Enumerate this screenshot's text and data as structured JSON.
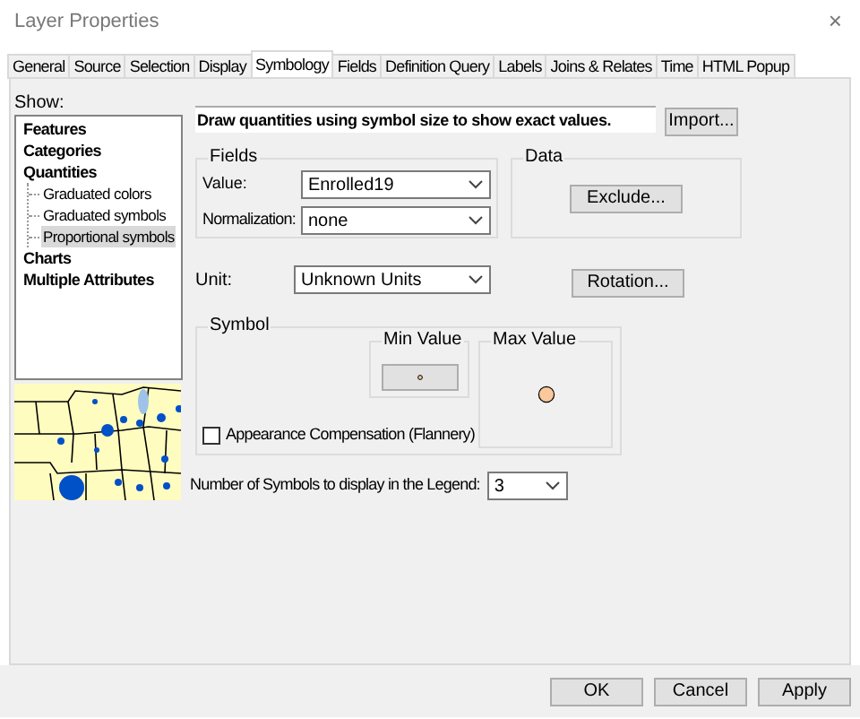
{
  "window": {
    "title": "Layer Properties",
    "close": "×"
  },
  "tabs": [
    {
      "label": "General",
      "selected": false
    },
    {
      "label": "Source",
      "selected": false
    },
    {
      "label": "Selection",
      "selected": false
    },
    {
      "label": "Display",
      "selected": false
    },
    {
      "label": "Symbology",
      "selected": true
    },
    {
      "label": "Fields",
      "selected": false
    },
    {
      "label": "Definition Query",
      "selected": false
    },
    {
      "label": "Labels",
      "selected": false
    },
    {
      "label": "Joins & Relates",
      "selected": false
    },
    {
      "label": "Time",
      "selected": false
    },
    {
      "label": "HTML Popup",
      "selected": false
    }
  ],
  "show": {
    "label": "Show:",
    "tree": [
      {
        "label": "Features",
        "selected": false
      },
      {
        "label": "Categories",
        "selected": false
      },
      {
        "label": "Quantities",
        "selected": false,
        "children": [
          {
            "label": "Graduated colors",
            "selected": false
          },
          {
            "label": "Graduated symbols",
            "selected": false
          },
          {
            "label": "Proportional symbols",
            "selected": true
          }
        ]
      },
      {
        "label": "Charts",
        "selected": false
      },
      {
        "label": "Multiple Attributes",
        "selected": false
      }
    ]
  },
  "description": "Draw quantities using symbol size to show exact values.",
  "import_button": "Import...",
  "fields": {
    "title": "Fields",
    "value_label": "Value:",
    "value": "Enrolled19",
    "normalization_label": "Normalization:",
    "normalization": "none"
  },
  "data": {
    "title": "Data",
    "exclude_button": "Exclude..."
  },
  "unit": {
    "label": "Unit:",
    "value": "Unknown Units"
  },
  "rotation_button": "Rotation...",
  "symbol": {
    "title": "Symbol",
    "min_label": "Min Value",
    "max_label": "Max Value",
    "appearance_compensation": {
      "label": "Appearance Compensation (Flannery)",
      "checked": false
    }
  },
  "legend": {
    "label": "Number of Symbols to display in the Legend:",
    "value": "3"
  },
  "buttons": [
    "OK",
    "Cancel",
    "Apply"
  ]
}
